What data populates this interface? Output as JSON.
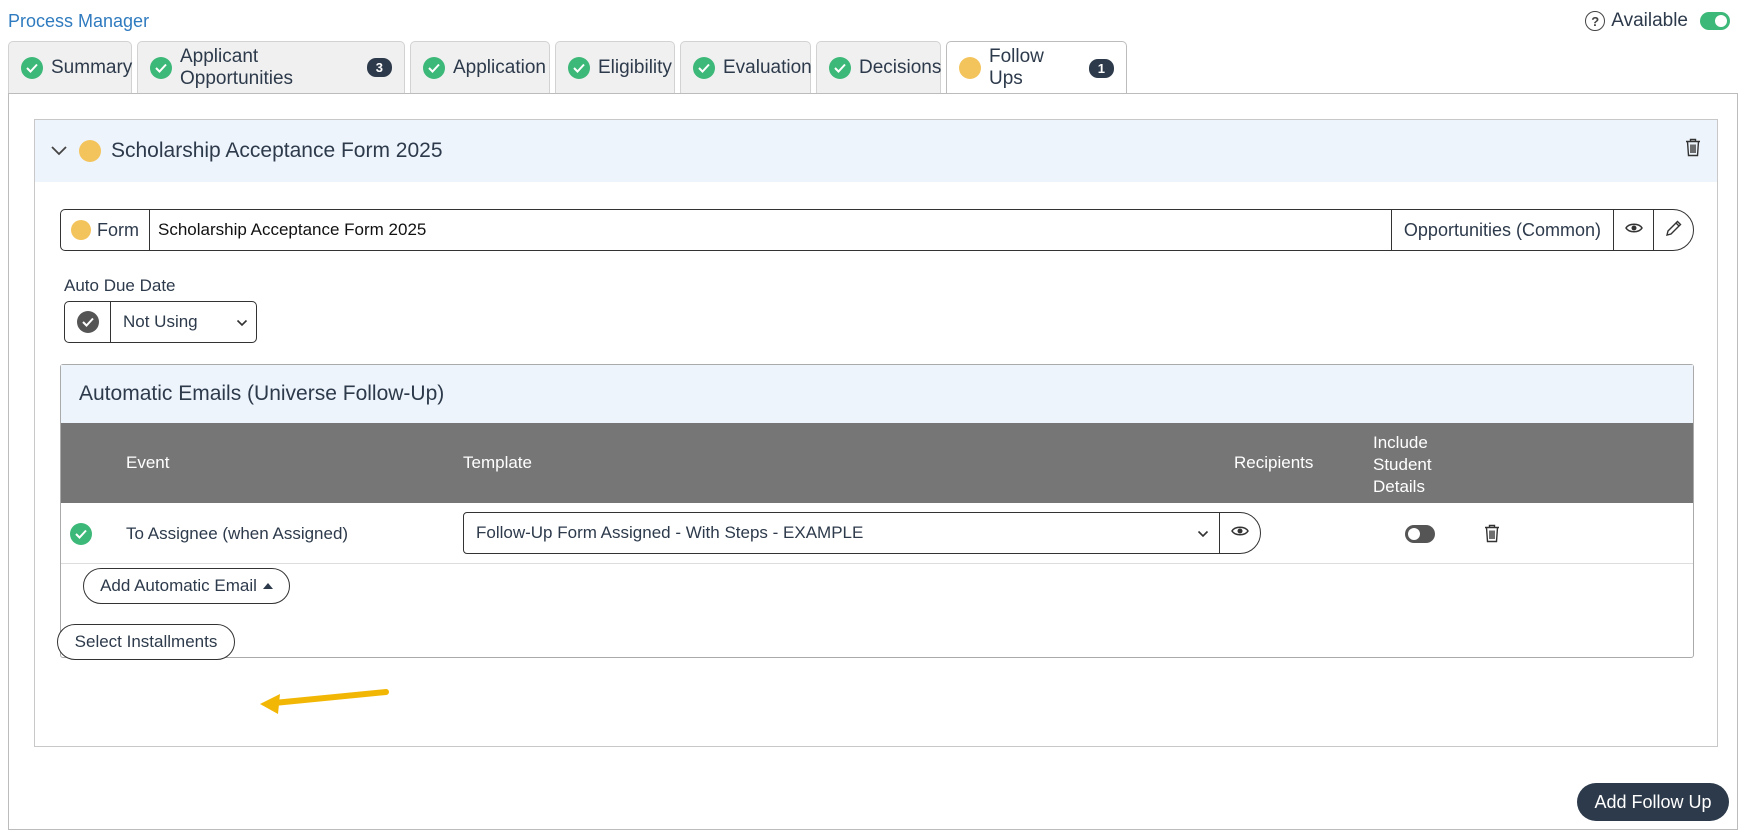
{
  "header": {
    "title": "Process Manager",
    "availability_label": "Available",
    "availability_on": true
  },
  "tabs": [
    {
      "label": "Summary",
      "status": "complete"
    },
    {
      "label": "Applicant Opportunities",
      "status": "complete",
      "badge": "3"
    },
    {
      "label": "Application",
      "status": "complete"
    },
    {
      "label": "Eligibility",
      "status": "complete"
    },
    {
      "label": "Evaluation",
      "status": "complete"
    },
    {
      "label": "Decisions",
      "status": "complete"
    },
    {
      "label": "Follow Ups",
      "status": "pending",
      "badge": "1",
      "active": true
    }
  ],
  "followup": {
    "title": "Scholarship Acceptance Form 2025",
    "form_label": "Form",
    "form_value": "Scholarship Acceptance Form 2025",
    "opportunities_label": "Opportunities (Common)",
    "auto_due_date_label": "Auto Due Date",
    "auto_due_date_value": "Not Using"
  },
  "emails": {
    "title": "Automatic Emails (Universe Follow-Up)",
    "columns": {
      "event": "Event",
      "template": "Template",
      "recipients": "Recipients",
      "include_line1": "Include",
      "include_line2": "Student",
      "include_line3": "Details"
    },
    "rows": [
      {
        "event": "To Assignee (when Assigned)",
        "template": "Follow-Up Form Assigned - With Steps - EXAMPLE",
        "recipients": "",
        "include_student_details": false
      }
    ],
    "add_button": "Add Automatic Email"
  },
  "select_installments_button": "Select Installments",
  "add_followup_button": "Add Follow Up",
  "colors": {
    "accent_green": "#3cb878",
    "pending_yellow": "#f4c45c",
    "header_gray": "#767676",
    "dark_navy": "#2d3a4b",
    "link_blue": "#2f7bbf",
    "annotation_arrow": "#f2b705"
  },
  "icons": [
    "check-circle-icon",
    "pending-dot-icon",
    "trash-icon",
    "eye-icon",
    "pencil-icon",
    "chevron-down-icon",
    "help-icon",
    "toggle-icon",
    "caret-up-icon"
  ]
}
